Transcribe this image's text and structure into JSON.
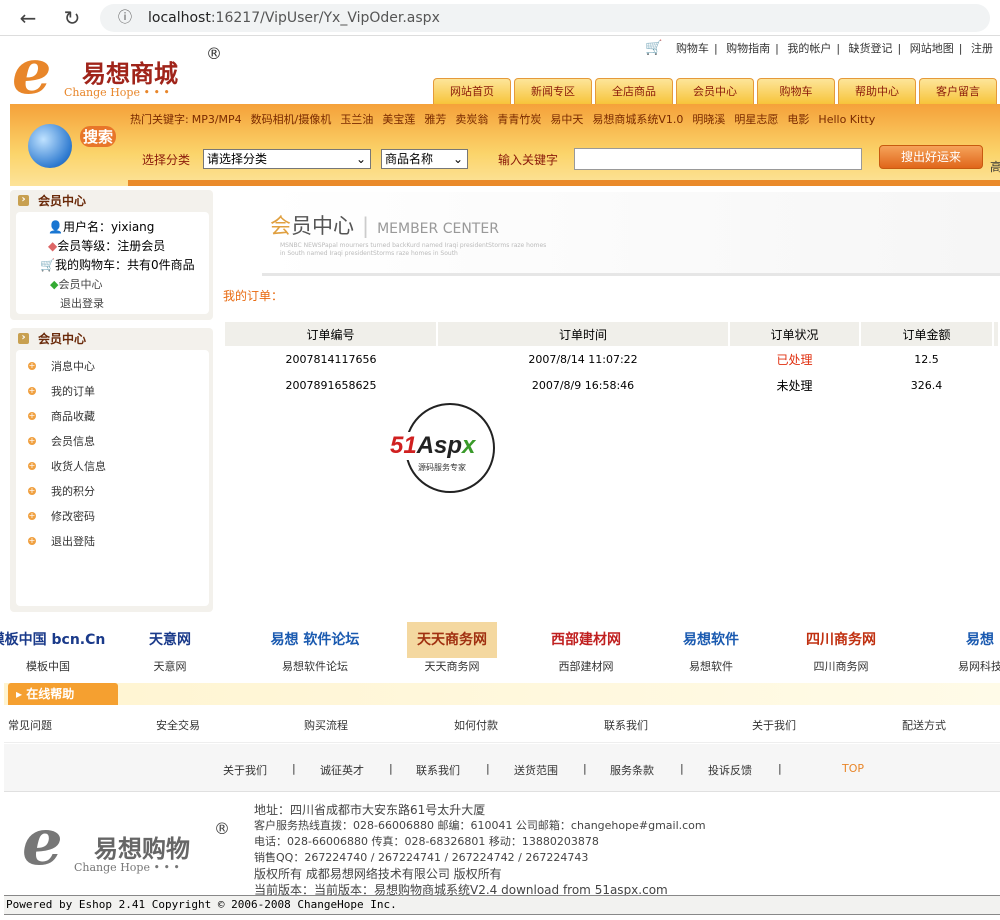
{
  "browser": {
    "url_host": "localhost",
    "url_path": ":16217/VipUser/Yx_VipOder.aspx"
  },
  "top_links": [
    "购物车",
    "购物指南",
    "我的帐户",
    "缺货登记",
    "网站地图",
    "注册"
  ],
  "logo": {
    "name": "易想商城",
    "sub": "Change Hope • • •",
    "reg": "®"
  },
  "nav_tabs": [
    "网站首页",
    "新闻专区",
    "全店商品",
    "会员中心",
    "购物车",
    "帮助中心",
    "客户留言"
  ],
  "search": {
    "badge": "搜索",
    "hot_label": "热门关键字:",
    "hot_keywords": [
      "MP3/MP4",
      "数码相机/摄像机",
      "玉兰油",
      "美宝莲",
      "雅芳",
      "卖炭翁",
      "青青竹炭",
      "易中天",
      "易想商城系统V1.0",
      "明晓溪",
      "明星志愿",
      "电影",
      "Hello Kitty"
    ],
    "category_label": "选择分类",
    "category_value": "请选择分类",
    "field_value": "商品名称",
    "keyword_label": "输入关键字",
    "keyword_value": "",
    "button": "搜出好运来",
    "extra": "高"
  },
  "member_box": {
    "title": "会员中心",
    "username": "用户名：yixiang",
    "level": "会员等级：注册会员",
    "cart": "我的购物车：共有0件商品",
    "center": "会员中心",
    "logout": "退出登录"
  },
  "menu_box": {
    "title": "会员中心",
    "items": [
      "消息中心",
      "我的订单",
      "商品收藏",
      "会员信息",
      "收货人信息",
      "我的积分",
      "修改密码",
      "退出登陆"
    ]
  },
  "banner": {
    "title_a": "会",
    "title_b": "员中心",
    "title_en": "MEMBER CENTER",
    "blurb": "MSNBC NEWSPapal mourners turned backKurd named Iraqi presidentStorms raze homes in South named Iraqi presidentStorms raze homes in South"
  },
  "orders": {
    "title": "我的订单：",
    "columns": [
      "订单编号",
      "订单时间",
      "订单状况",
      "订单金额"
    ],
    "rows": [
      [
        "2007814117656",
        "2007/8/14 11:07:22",
        "已处理",
        "12.5"
      ],
      [
        "2007891658625",
        "2007/8/9 16:58:46",
        "未处理",
        "326.4"
      ]
    ],
    "processed_color": "#e03010"
  },
  "watermark": {
    "brand": "51Aspx",
    "sub": "源码服务专家"
  },
  "partners": [
    {
      "logo": "模板中国 bcn.Cn",
      "name": "模板中国"
    },
    {
      "logo": "天意网",
      "name": "天意网"
    },
    {
      "logo": "易想 软件论坛",
      "name": "易想软件论坛"
    },
    {
      "logo": "天天商务网",
      "name": "天天商务网"
    },
    {
      "logo": "西部建材网",
      "name": "西部建材网"
    },
    {
      "logo": "易想软件",
      "name": "易想软件"
    },
    {
      "logo": "四川商务网",
      "name": "四川商务网"
    },
    {
      "logo": "易想",
      "name": "易网科技"
    }
  ],
  "online_help": {
    "title": "在线帮助",
    "links": [
      "常见问题",
      "安全交易",
      "购买流程",
      "如何付款",
      "联系我们",
      "关于我们",
      "配送方式"
    ]
  },
  "footer_links": [
    "关于我们",
    "诚征英才",
    "联系我们",
    "送货范围",
    "服务条款",
    "投诉反馈",
    "TOP"
  ],
  "footer_logo": {
    "name": "易想购物",
    "sub": "Change Hope • • •"
  },
  "footer_info": [
    "地址：四川省成都市大安东路61号太升大厦",
    "客户服务热线直拨：028-66006880 邮编：610041 公司邮箱：changehope#gmail.com",
    "电话：028-66006880 传真：028-68326801 移动：13880203878",
    "销售QQ：267224740 / 267224741 / 267224742 / 267224743",
    "版权所有 成都易想网络技术有限公司 版权所有",
    "当前版本：当前版本：易想购物商城系统V2.4 download from 51aspx.com"
  ],
  "powered": "Powered by Eshop 2.41 Copyright © 2006-2008 ChangeHope Inc."
}
